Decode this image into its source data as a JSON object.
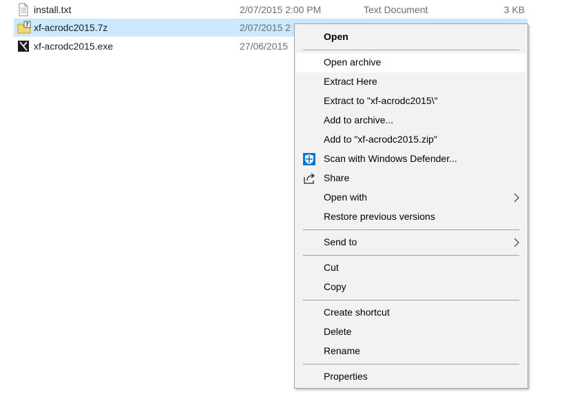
{
  "files": [
    {
      "name": "install.txt",
      "date": "2/07/2015 2:00 PM",
      "type": "Text Document",
      "size": "3 KB",
      "icon": "text-document-icon"
    },
    {
      "name": "xf-acrodc2015.7z",
      "date": "2/07/2015 2",
      "icon": "7z-archive-icon",
      "selected": true
    },
    {
      "name": "xf-acrodc2015.exe",
      "date": "27/06/2015",
      "icon": "executable-icon"
    }
  ],
  "menu": {
    "open": "Open",
    "open_archive": "Open archive",
    "extract_here": "Extract Here",
    "extract_to": "Extract to \"xf-acrodc2015\\\"",
    "add_to_archive": "Add to archive...",
    "add_to_zip": "Add to \"xf-acrodc2015.zip\"",
    "scan_defender": "Scan with Windows Defender...",
    "share": "Share",
    "open_with": "Open with",
    "restore_versions": "Restore previous versions",
    "send_to": "Send to",
    "cut": "Cut",
    "copy": "Copy",
    "create_shortcut": "Create shortcut",
    "delete": "Delete",
    "rename": "Rename",
    "properties": "Properties"
  },
  "colors": {
    "selection": "#cce8ff",
    "menu_bg": "#f2f2f2",
    "defender_blue": "#0078d7"
  }
}
